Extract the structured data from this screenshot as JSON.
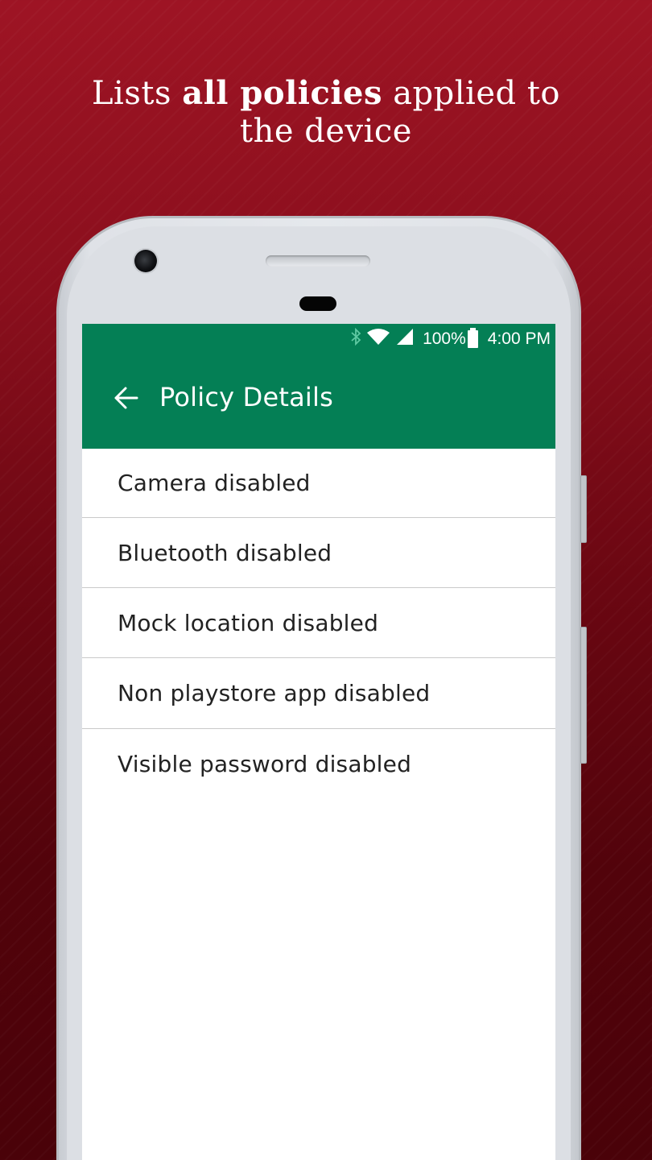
{
  "promo": {
    "line1_pre": "Lists ",
    "line1_bold": "all policies",
    "line1_post": " applied to",
    "line2": "the device"
  },
  "statusbar": {
    "battery": "100%",
    "time": "4:00 PM"
  },
  "appbar": {
    "title": "Policy Details"
  },
  "policies": [
    "Camera disabled",
    "Bluetooth disabled",
    "Mock location disabled",
    "Non playstore app disabled",
    "Visible password disabled"
  ],
  "colors": {
    "appbar": "#047f55",
    "background": "#8a0f1d"
  }
}
